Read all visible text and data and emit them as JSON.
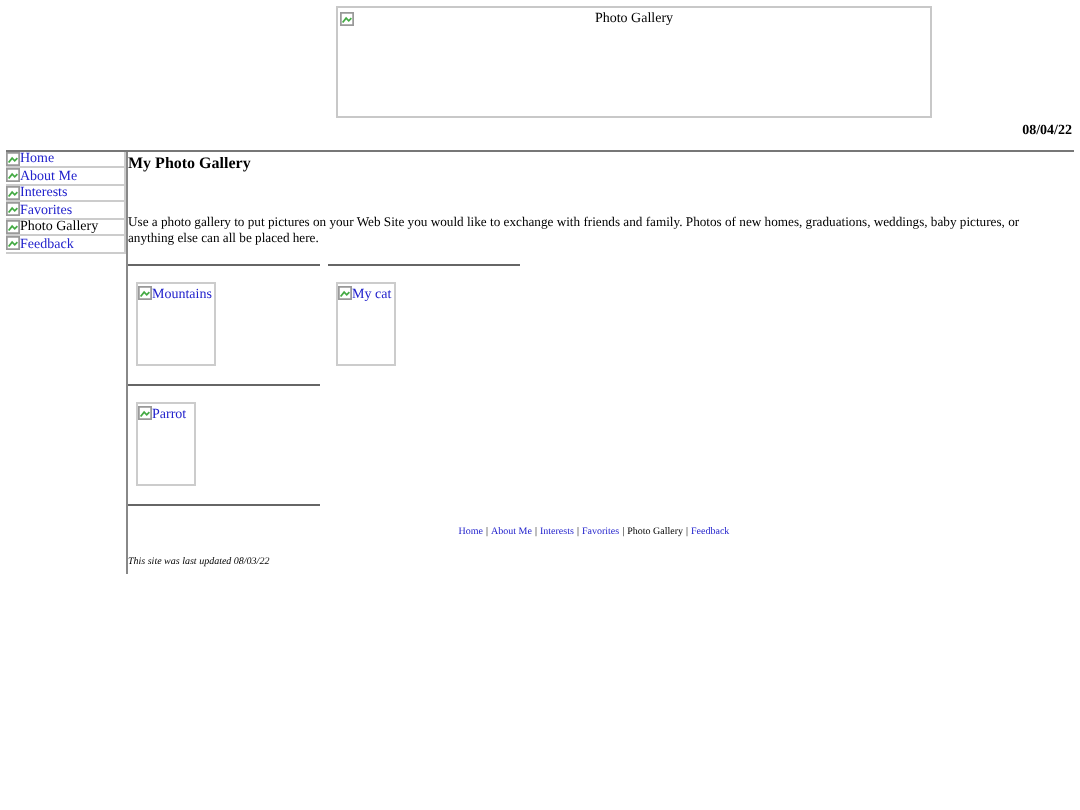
{
  "banner": {
    "alt": "Photo Gallery"
  },
  "date": "08/04/22",
  "nav": [
    {
      "label": "Home",
      "selected": false
    },
    {
      "label": "About Me",
      "selected": false
    },
    {
      "label": "Interests",
      "selected": false
    },
    {
      "label": "Favorites",
      "selected": false
    },
    {
      "label": "Photo Gallery",
      "selected": true
    },
    {
      "label": "Feedback",
      "selected": false
    }
  ],
  "heading": "My Photo Gallery",
  "intro": "Use a photo gallery to put pictures on your Web Site you would like to exchange with friends and family. Photos of new homes, graduations, weddings, baby pictures, or anything else can all be placed here.",
  "photos": [
    {
      "alt": "Mountains"
    },
    {
      "alt": "My cat"
    },
    {
      "alt": "Parrot"
    }
  ],
  "footer_nav": [
    {
      "label": "Home",
      "selected": false
    },
    {
      "label": "About Me",
      "selected": false
    },
    {
      "label": "Interests",
      "selected": false
    },
    {
      "label": "Favorites",
      "selected": false
    },
    {
      "label": "Photo Gallery",
      "selected": true
    },
    {
      "label": "Feedback",
      "selected": false
    }
  ],
  "footer_separator": "|",
  "updated": "This site was last updated 08/03/22"
}
